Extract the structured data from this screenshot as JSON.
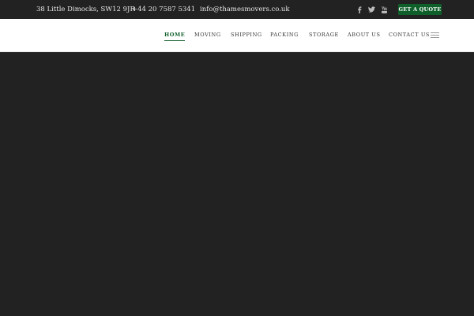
{
  "topbar": {
    "address": "38 Little Dimocks, SW12 9JR",
    "phone": "+44 20 7587 5341",
    "email": "info@thamesmovers.co.uk",
    "social_icons": [
      "facebook-icon",
      "twitter-icon",
      "youtube-icon"
    ],
    "quote_button_label": "GET A QUOTE"
  },
  "nav": {
    "items": [
      {
        "label": "HOME",
        "active": true
      },
      {
        "label": "MOVING",
        "active": false
      },
      {
        "label": "SHIPPING",
        "active": false
      },
      {
        "label": "PACKING",
        "active": false
      },
      {
        "label": "STORAGE",
        "active": false
      },
      {
        "label": "ABOUT US",
        "active": false
      },
      {
        "label": "CONTACT US",
        "active": false
      }
    ],
    "menu_icon": "hamburger-menu-icon"
  },
  "colors": {
    "accent": "#0f5f2a",
    "topbar_bg": "#222222",
    "nav_bg": "#ffffff",
    "hero_bg": "#222222"
  }
}
